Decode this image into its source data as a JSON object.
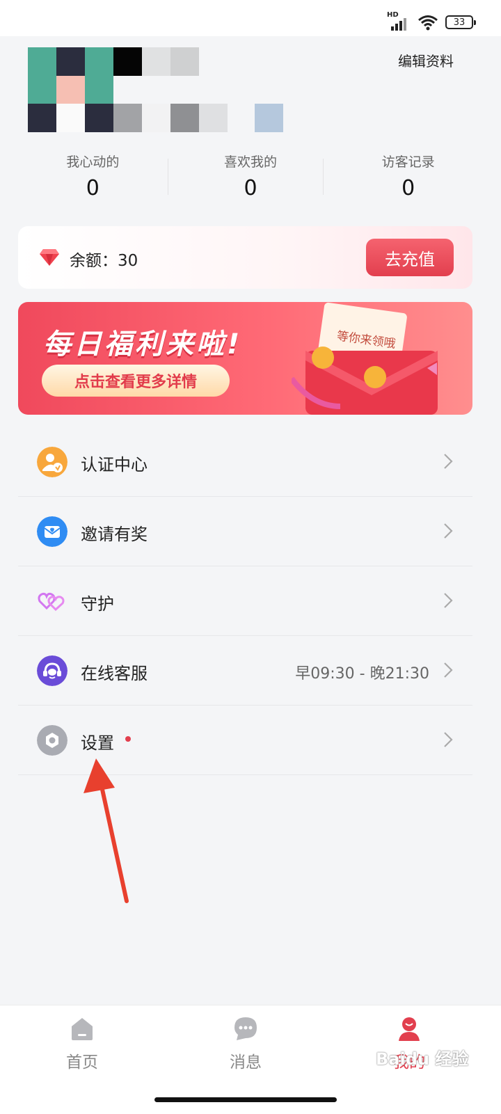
{
  "status_bar": {
    "signal_label": "HD",
    "battery": "33"
  },
  "header": {
    "edit_profile": "编辑资料"
  },
  "stats": [
    {
      "label": "我心动的",
      "value": "0"
    },
    {
      "label": "喜欢我的",
      "value": "0"
    },
    {
      "label": "访客记录",
      "value": "0"
    }
  ],
  "balance": {
    "text": "余额：30",
    "recharge_label": "去充值"
  },
  "promo": {
    "title": "每日福利来啦!",
    "button": "点击查看更多详情",
    "ticket_text": "等你来领哦"
  },
  "menu": [
    {
      "label": "认证中心",
      "icon": "verify-icon",
      "color": "#f8a73c"
    },
    {
      "label": "邀请有奖",
      "icon": "invite-mail-icon",
      "color": "#2f8cf3"
    },
    {
      "label": "守护",
      "icon": "hearts-icon",
      "color": "#d277f0"
    },
    {
      "label": "在线客服",
      "sub": "早09:30 - 晚21:30",
      "icon": "customer-service-icon",
      "color": "#6a4cd8"
    },
    {
      "label": "设置",
      "icon": "settings-icon",
      "color": "#a9abb2",
      "badge_dot": true
    }
  ],
  "tabs": [
    {
      "label": "首页",
      "icon": "home-icon"
    },
    {
      "label": "消息",
      "icon": "message-icon"
    },
    {
      "label": "我的",
      "icon": "profile-icon",
      "active": true
    }
  ],
  "watermark": "Baidu 经验",
  "colors": {
    "accent": "#e23f4e",
    "background": "#f4f5f7"
  }
}
